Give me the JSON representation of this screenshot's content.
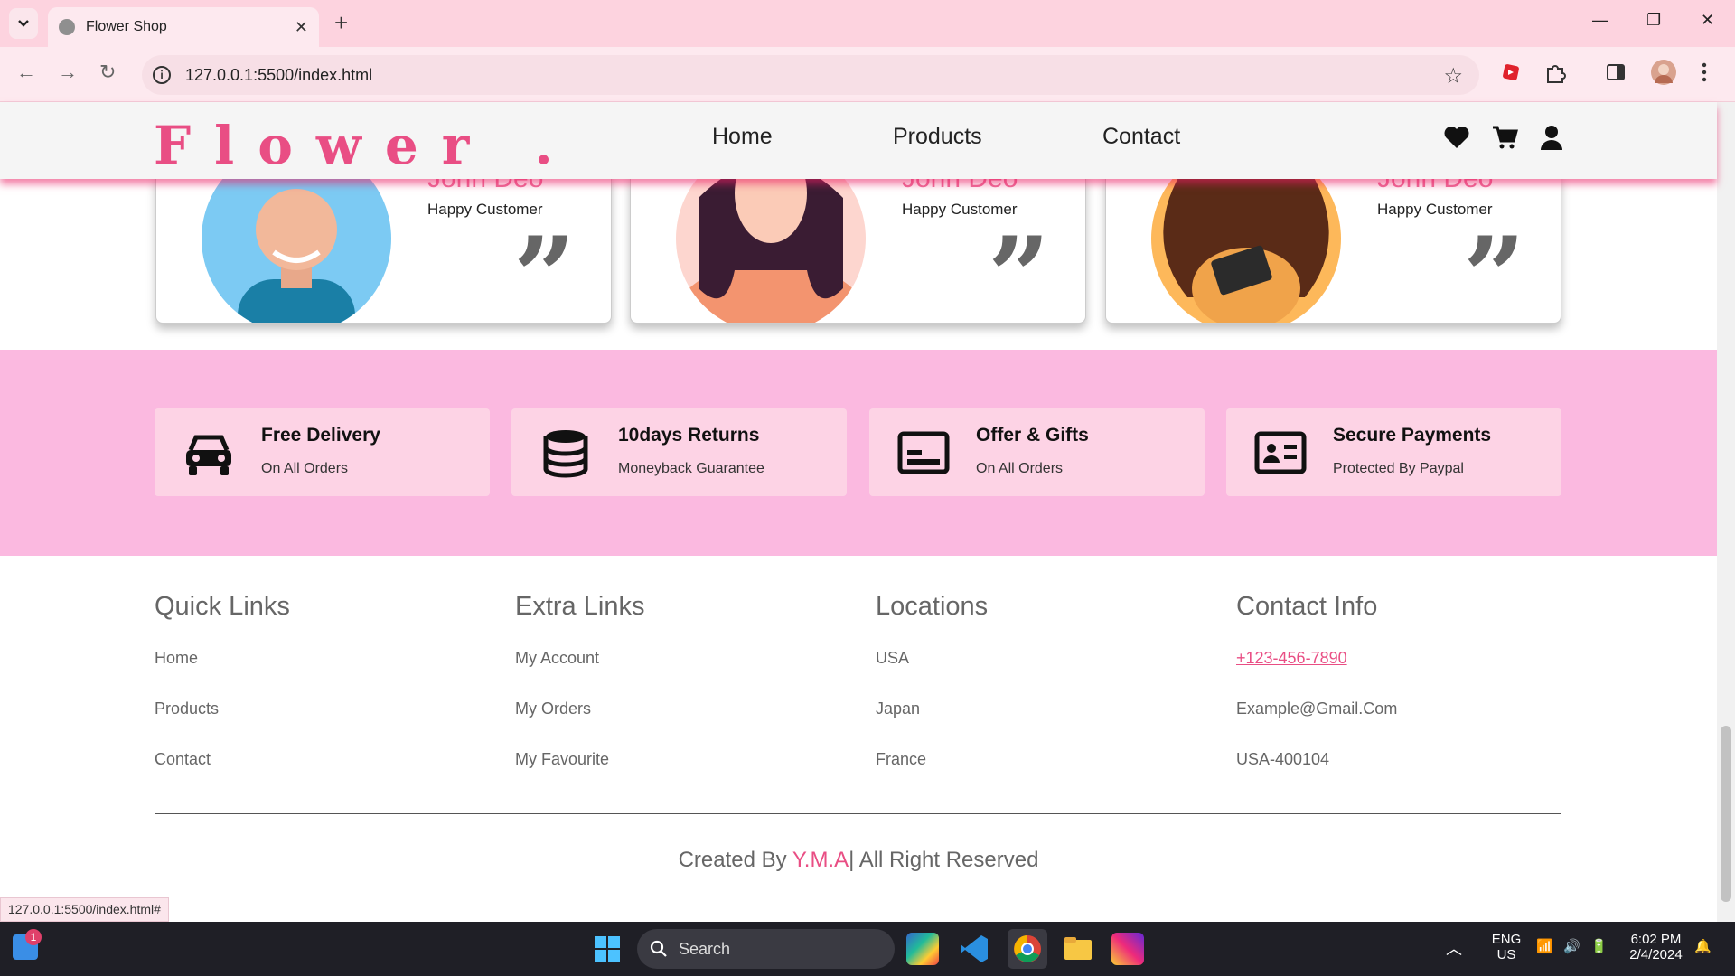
{
  "browser": {
    "tab_title": "Flower Shop",
    "url": "127.0.0.1:5500/index.html",
    "status_url": "127.0.0.1:5500/index.html#"
  },
  "site": {
    "logo": "Flower .",
    "nav": [
      "Home",
      "Products",
      "Contact"
    ],
    "accent_color": "#e94e84"
  },
  "reviews": [
    {
      "name": "John Deo",
      "role": "Happy Customer"
    },
    {
      "name": "John Deo",
      "role": "Happy Customer"
    },
    {
      "name": "John Deo",
      "role": "Happy Customer"
    }
  ],
  "features": [
    {
      "title": "Free Delivery",
      "subtitle": "On All Orders",
      "icon": "car-icon"
    },
    {
      "title": "10days Returns",
      "subtitle": "Moneyback Guarantee",
      "icon": "database-icon"
    },
    {
      "title": "Offer & Gifts",
      "subtitle": "On All Orders",
      "icon": "gift-card-icon"
    },
    {
      "title": "Secure Payments",
      "subtitle": "Protected By Paypal",
      "icon": "id-card-icon"
    }
  ],
  "footer": {
    "columns": [
      {
        "heading": "Quick Links",
        "links": [
          "Home",
          "Products",
          "Contact"
        ]
      },
      {
        "heading": "Extra Links",
        "links": [
          "My Account",
          "My Orders",
          "My Favourite"
        ]
      },
      {
        "heading": "Locations",
        "links": [
          "USA",
          "Japan",
          "France"
        ]
      },
      {
        "heading": "Contact Info",
        "links": [
          "+123-456-7890",
          "Example@Gmail.Com",
          "USA-400104"
        ]
      }
    ],
    "credit_prefix": "Created By ",
    "credit_name": "Y.M.A",
    "credit_suffix": "| All Right Reserved"
  },
  "taskbar": {
    "search_placeholder": "Search",
    "notification_count": "1",
    "lang": "ENG",
    "region": "US",
    "time": "6:02 PM",
    "date": "2/4/2024"
  }
}
